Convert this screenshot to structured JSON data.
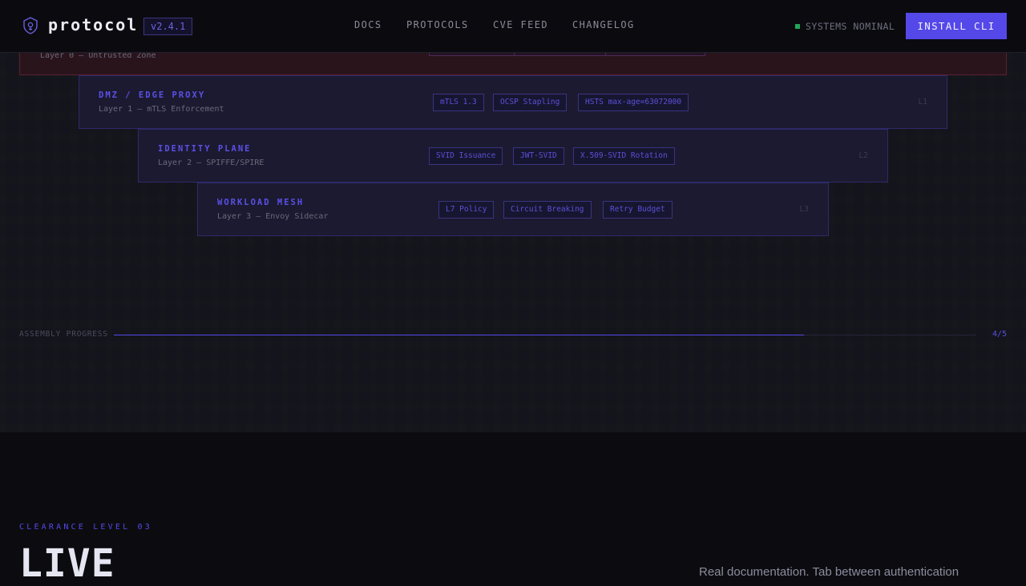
{
  "header": {
    "brand": "protocol",
    "version": "v2.4.1",
    "nav": [
      "DOCS",
      "PROTOCOLS",
      "CVE FEED",
      "CHANGELOG"
    ],
    "status": "SYSTEMS NOMINAL",
    "install_label": "INSTALL CLI",
    "logo_icon": "shield-icon"
  },
  "layers": [
    {
      "title": "",
      "subtitle": "Layer 0 — Untrusted Zone",
      "tags": [
        "",
        "",
        ""
      ],
      "id": ""
    },
    {
      "title": "DMZ / EDGE PROXY",
      "subtitle": "Layer 1 — mTLS Enforcement",
      "tags": [
        "mTLS 1.3",
        "OCSP Stapling",
        "HSTS max-age=63072000"
      ],
      "id": "L1"
    },
    {
      "title": "IDENTITY PLANE",
      "subtitle": "Layer 2 — SPIFFE/SPIRE",
      "tags": [
        "SVID Issuance",
        "JWT-SVID",
        "X.509-SVID Rotation"
      ],
      "id": "L2"
    },
    {
      "title": "WORKLOAD MESH",
      "subtitle": "Layer 3 — Envoy Sidecar",
      "tags": [
        "L7 Policy",
        "Circuit Breaking",
        "Retry Budget"
      ],
      "id": "L3"
    }
  ],
  "progress": {
    "label": "ASSEMBLY PROGRESS",
    "count": "4/5",
    "fraction": 0.8
  },
  "hero": {
    "eyebrow": "CLEARANCE LEVEL 03",
    "headline": "LIVE",
    "lead": "Real documentation. Tab between authentication"
  },
  "colors": {
    "accent": "#5548e8",
    "status_ok": "#22a559",
    "untrusted": "#2a141c"
  }
}
